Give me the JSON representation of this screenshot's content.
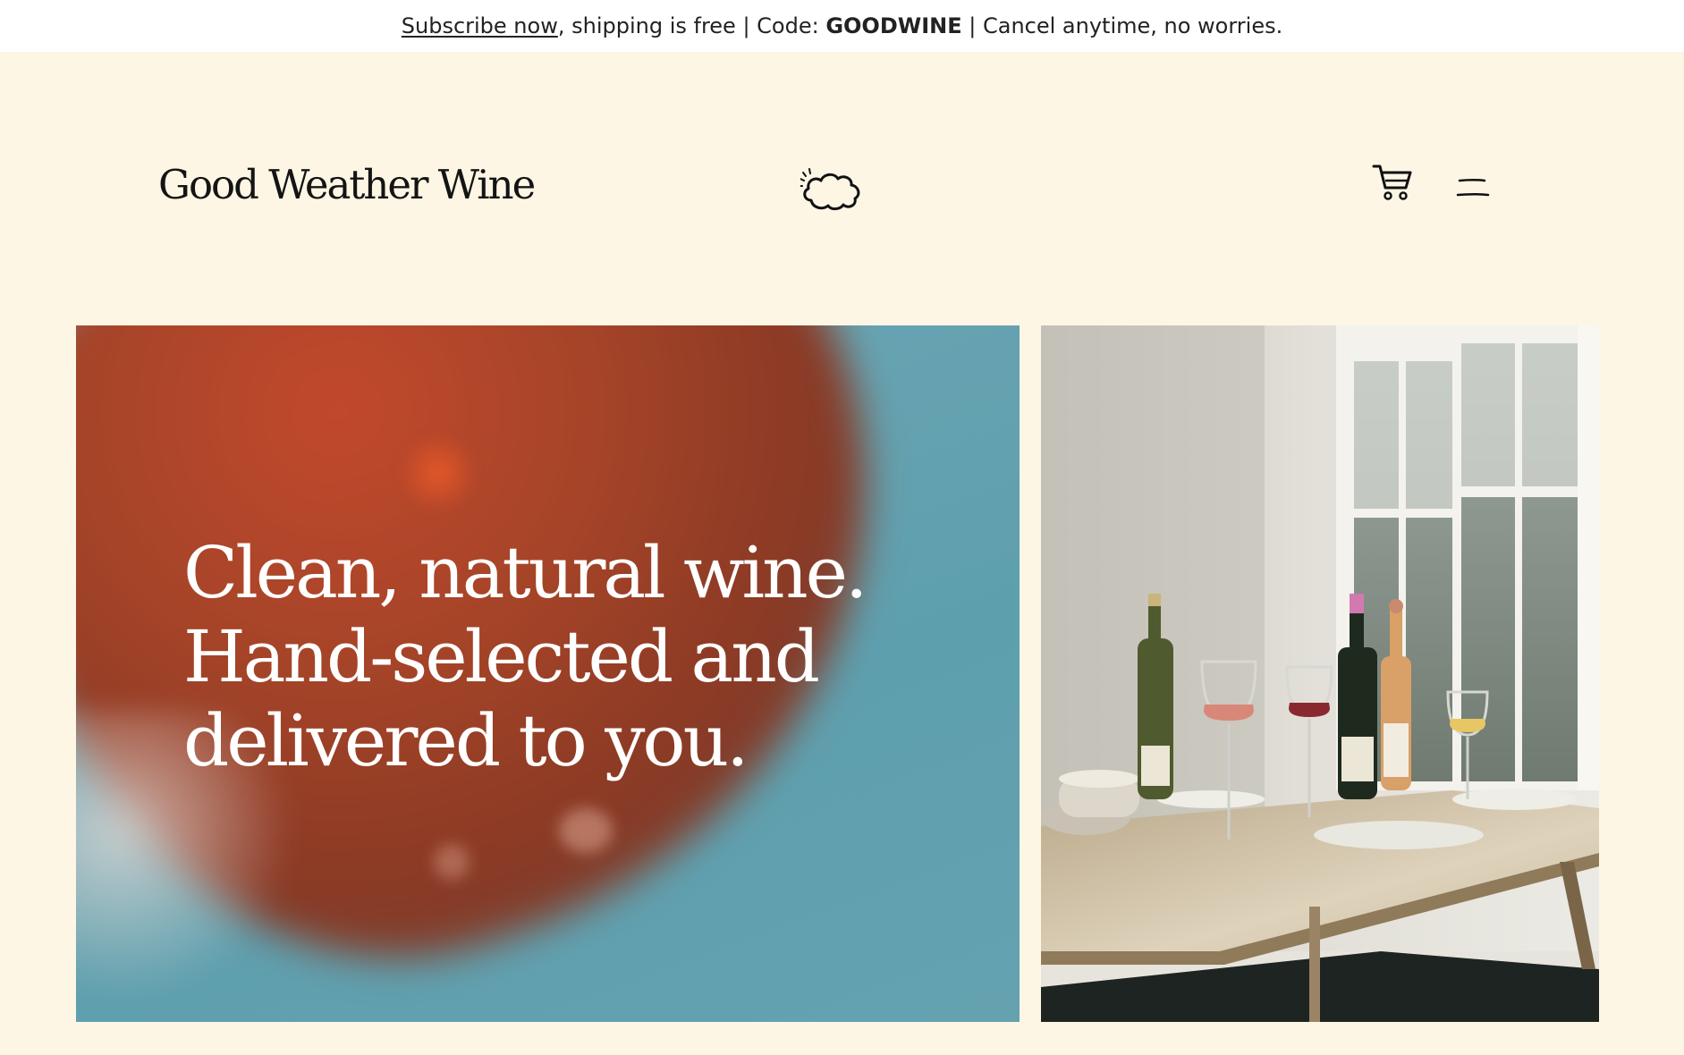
{
  "announcement": {
    "link_text": "Subscribe now",
    "middle_text": ", shipping is free | Code: ",
    "code": "GOODWINE",
    "tail_text": " | Cancel anytime, no worries."
  },
  "header": {
    "logo": "Good Weather Wine",
    "icons": [
      "cloud-icon",
      "cart-icon",
      "menu-icon"
    ]
  },
  "hero": {
    "headline_lines": [
      "Clean, natural wine.",
      "Hand-selected and",
      "delivered to you."
    ]
  },
  "colors": {
    "page_background": "#fdf6e5",
    "announcement_background": "#ffffff",
    "hero_text": "#ffffff",
    "wine_red": "#a54428",
    "sky_blue": "#64a2b0"
  }
}
